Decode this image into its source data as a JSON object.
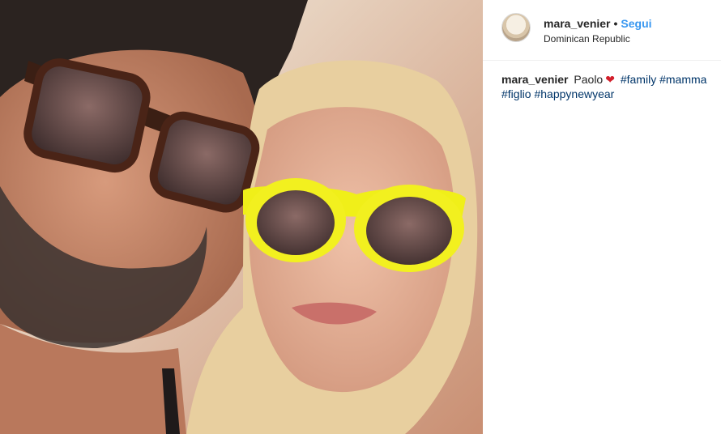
{
  "post": {
    "username": "mara_venier",
    "separator": "•",
    "follow_label": "Segui",
    "location": "Dominican Republic"
  },
  "caption": {
    "username": "mara_venier",
    "text": "Paolo",
    "emoji": "❤",
    "hashtags": [
      "#family",
      "#mamma",
      "#figlio",
      "#happynewyear"
    ]
  },
  "colors": {
    "follow": "#3897f0",
    "hashtag": "#003569",
    "heart": "#d21f2b"
  },
  "icons": {
    "avatar": "profile-avatar",
    "heart": "red-heart-emoji"
  }
}
